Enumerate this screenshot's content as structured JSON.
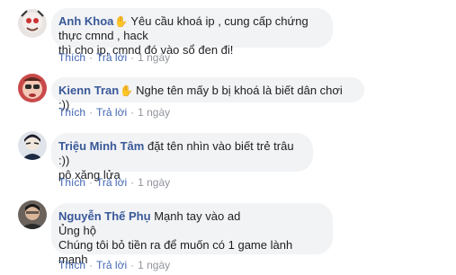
{
  "comments": [
    {
      "author": "Anh Khoa",
      "badge_icon": "waving-hand-icon",
      "text_lines": [
        "Yêu cầu khoá ip , cung cấp chứng thực cmnd , hack",
        "thì cho ip, cmnd đó vào sổ đen đi!"
      ],
      "actions": {
        "like": "Thích",
        "reply": "Trả lời",
        "time": "1 ngày"
      }
    },
    {
      "author": "Kienn Tran",
      "badge_icon": "waving-hand-icon",
      "text_lines": [
        "Nghe tên mấy b bị khoá là biết dân chơi :))"
      ],
      "actions": {
        "like": "Thích",
        "reply": "Trả lời",
        "time": "1 ngày"
      }
    },
    {
      "author": "Triệu Minh Tâm",
      "text_lines": [
        "đặt tên nhìn vào biết trẻ trâu :))",
        "pô xăng lửa"
      ],
      "actions": {
        "like": "Thích",
        "reply": "Trả lời",
        "time": "1 ngày"
      }
    },
    {
      "author": "Nguyễn Thế Phụ",
      "text_lines": [
        "Mạnh tay vào ad",
        "Ủng hộ",
        "Chúng tôi bỏ tiền ra để muốn có 1 game lành mạnh"
      ],
      "actions": {
        "like": "Thích",
        "reply": "Trả lời",
        "time": "1 ngày"
      }
    }
  ],
  "colors": {
    "author": "#385898",
    "bubble": "#f2f3f5",
    "action": "#4267b2",
    "meta": "#90949c"
  }
}
